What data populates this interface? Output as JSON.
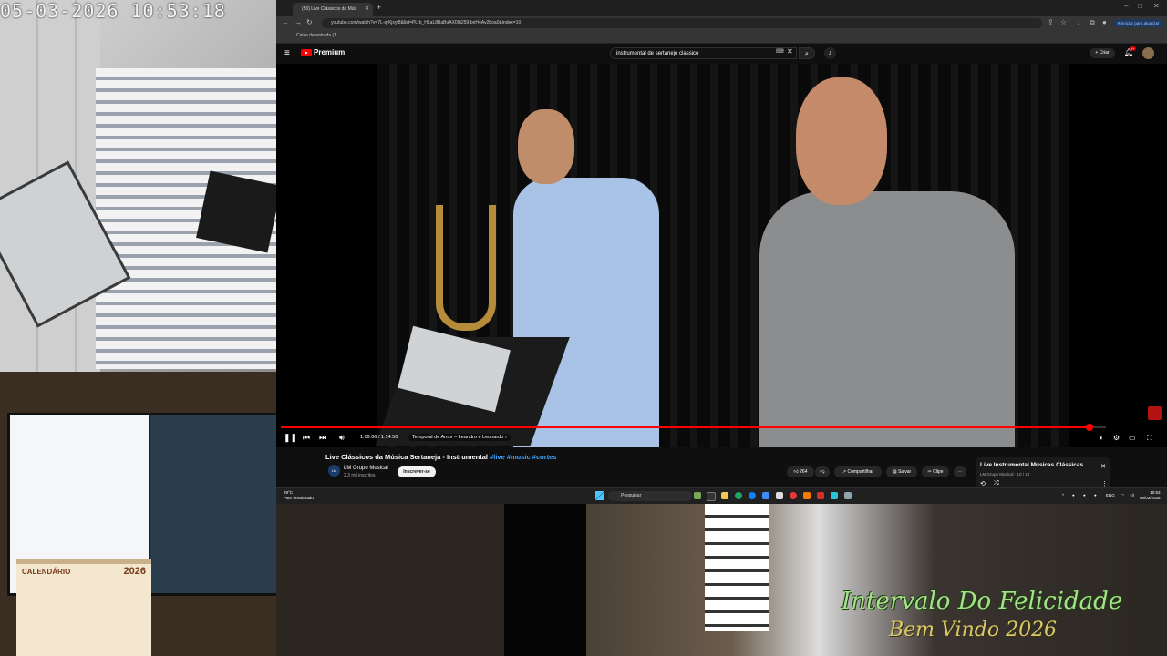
{
  "camera_left": {
    "timestamp": "05-03-2026 10:53:18"
  },
  "desk_camera": {
    "calendar_title": "CALENDÁRIO",
    "calendar_year": "2026"
  },
  "overlay": {
    "line1": "Intervalo Do Felicidade",
    "line2": "Bem Vindo 2026"
  },
  "browser": {
    "tab_title": "(50) Live Clássicos da Mús",
    "url": "youtube.com/watch?v=7L-qrKjxyf8&list=PLrb_HLaL8BaBuAX0Ih259-bnH4Av2boa0&index=10",
    "update_button": "Reiniciar para atualizar",
    "bookmark": "Caixa de entrada (1..."
  },
  "youtube": {
    "logo_text": "Premium",
    "search_query": "instrumental de sertanejo classico",
    "create_label": "Criar",
    "notif_count": "9+",
    "video": {
      "progress": 0.98,
      "time": "1:09:06 / 1:14:50",
      "chapter": "Temporal de Amor – Leandro e Leonardo"
    },
    "title_main": "Live Clássicos da Música Sertaneja - Instrumental",
    "title_tags": "#live #music #cortes",
    "channel": {
      "name": "LM Grupo Musical",
      "subs": "2,3 mil inscritos",
      "avatar_text": "LM"
    },
    "subscribe_label": "Inscrever-se",
    "likes": "264",
    "share_label": "Compartilhar",
    "save_label": "Salvar",
    "clip_label": "Clipe",
    "miniplayer": {
      "title": "Live Instrumental Músicas Clássicas ...",
      "subtitle": "LM Grupo Musical · 10 / 13"
    }
  },
  "taskbar": {
    "temp": "29°C",
    "weather": "Parc ensolarado",
    "search_placeholder": "Pesquisar",
    "lang": "ENG",
    "time": "10:53",
    "date": "05/03/2026"
  }
}
